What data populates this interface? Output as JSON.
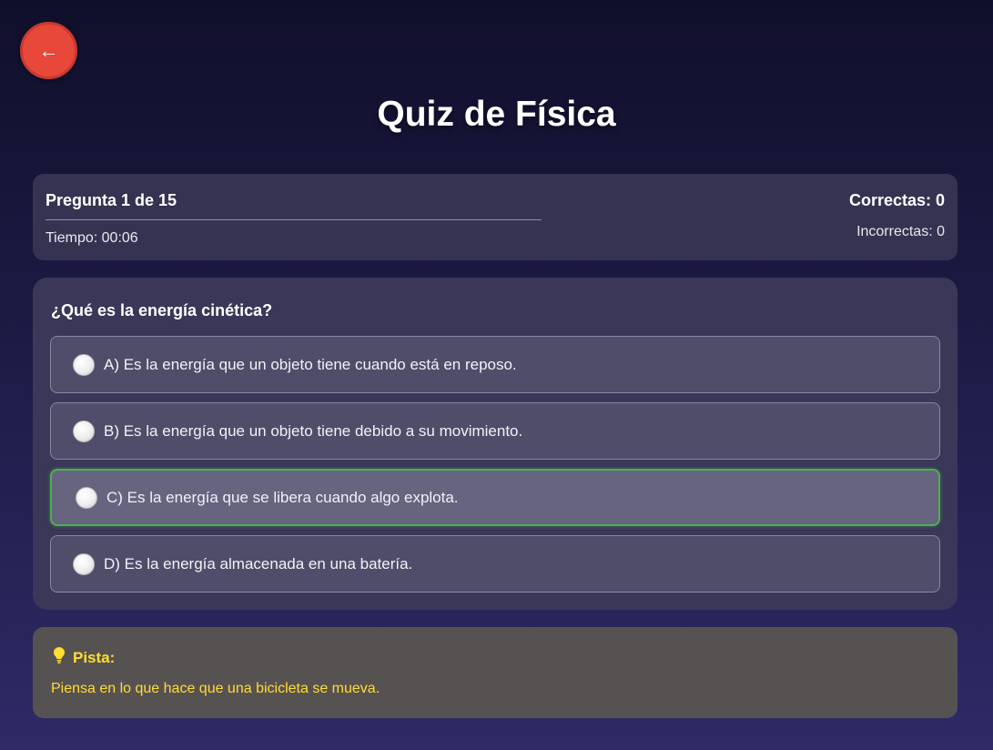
{
  "nav": {
    "back_label": "←"
  },
  "page": {
    "title": "Quiz de Física"
  },
  "stats": {
    "question_counter": "Pregunta 1 de 15",
    "timer": "Tiempo: 00:06",
    "correct": "Correctas: 0",
    "incorrect": "Incorrectas: 0"
  },
  "question": {
    "text": "¿Qué es la energía cinética?",
    "options": [
      {
        "label": "A) Es la energía que un objeto tiene cuando está en reposo.",
        "selected": false
      },
      {
        "label": "B) Es la energía que un objeto tiene debido a su movimiento.",
        "selected": false
      },
      {
        "label": "C) Es la energía que se libera cuando algo explota.",
        "selected": true
      },
      {
        "label": "D) Es la energía almacenada en una batería.",
        "selected": false
      }
    ]
  },
  "hint": {
    "icon": "lightbulb-icon",
    "title": "Pista:",
    "text": "Piensa en lo que hace que una bicicleta se mueva."
  },
  "colors": {
    "back_button": "#e8483a",
    "selected_border": "#4caf50",
    "hint_text": "#ffdd33"
  }
}
